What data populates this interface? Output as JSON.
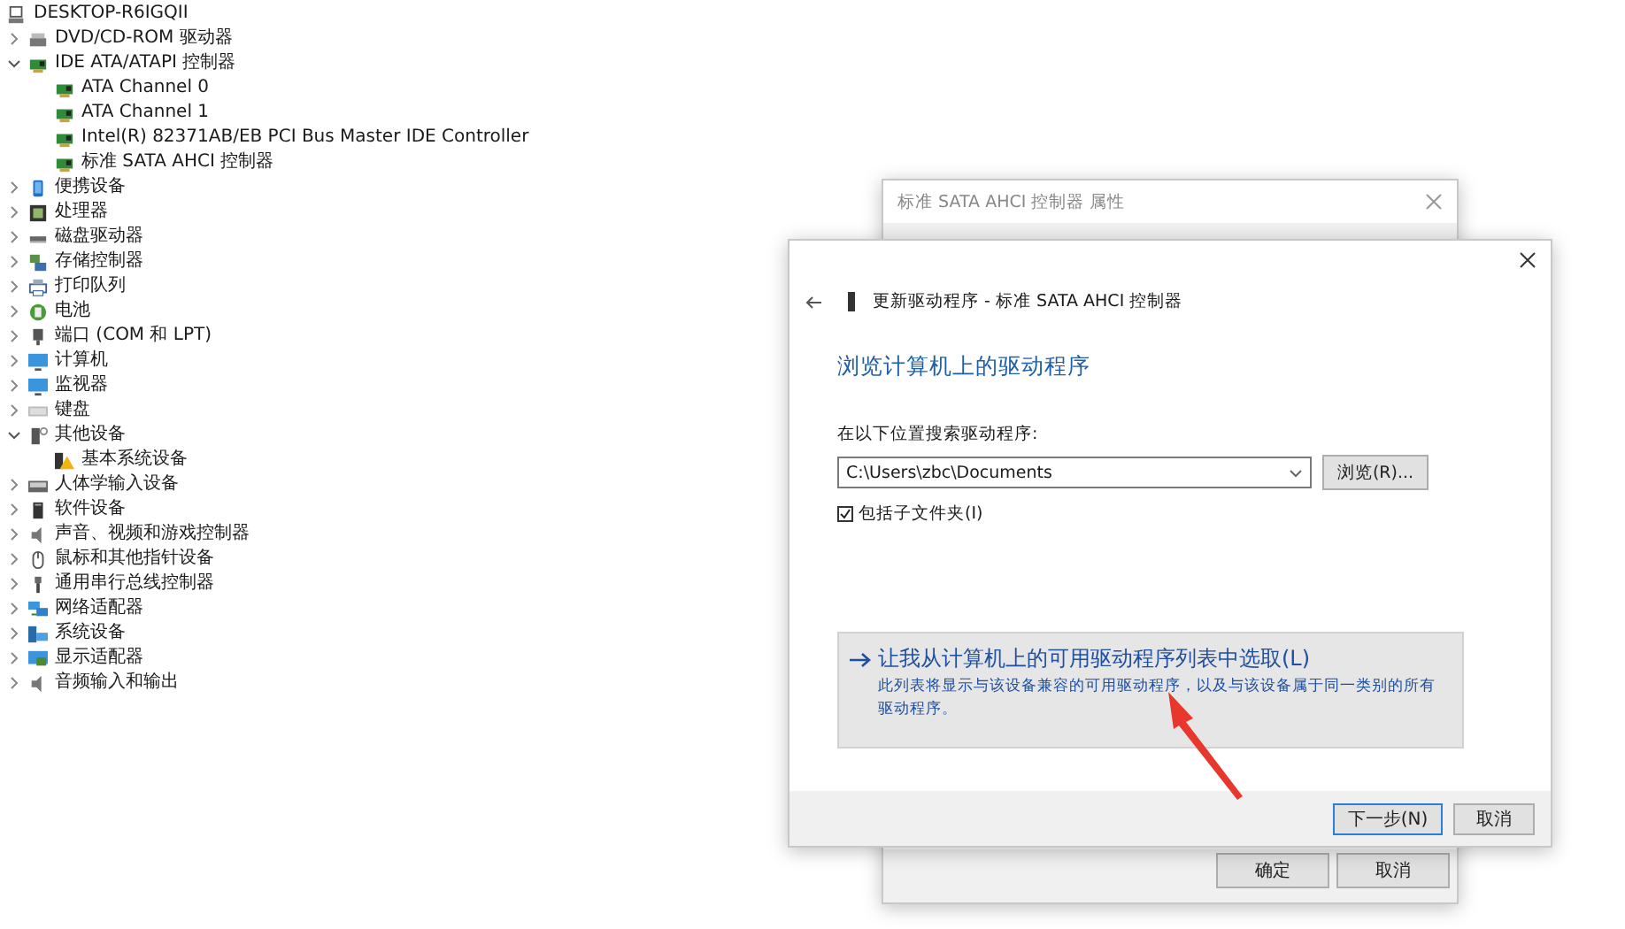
{
  "computer": {
    "label": "DESKTOP-R6IGQII"
  },
  "categories": [
    {
      "label": "DVD/CD-ROM 驱动器",
      "kind": "drive",
      "expanded": false
    },
    {
      "label": "IDE ATA/ATAPI 控制器",
      "kind": "controller",
      "expanded": true,
      "children": [
        {
          "label": "ATA Channel 0",
          "kind": "controller"
        },
        {
          "label": "ATA Channel 1",
          "kind": "controller"
        },
        {
          "label": "Intel(R) 82371AB/EB PCI Bus Master IDE Controller",
          "kind": "controller"
        },
        {
          "label": "标准 SATA AHCI 控制器",
          "kind": "controller"
        }
      ]
    },
    {
      "label": "便携设备",
      "kind": "portable",
      "expanded": false
    },
    {
      "label": "处理器",
      "kind": "chip",
      "expanded": false
    },
    {
      "label": "磁盘驱动器",
      "kind": "disk",
      "expanded": false
    },
    {
      "label": "存储控制器",
      "kind": "storage",
      "expanded": false
    },
    {
      "label": "打印队列",
      "kind": "printer",
      "expanded": false
    },
    {
      "label": "电池",
      "kind": "battery",
      "expanded": false
    },
    {
      "label": "端口 (COM 和 LPT)",
      "kind": "port",
      "expanded": false
    },
    {
      "label": "计算机",
      "kind": "monitor",
      "expanded": false
    },
    {
      "label": "监视器",
      "kind": "monitor",
      "expanded": false
    },
    {
      "label": "键盘",
      "kind": "keyboard",
      "expanded": false
    },
    {
      "label": "其他设备",
      "kind": "unknown",
      "expanded": true,
      "children": [
        {
          "label": "基本系统设备",
          "kind": "warning"
        }
      ]
    },
    {
      "label": "人体学输入设备",
      "kind": "hid",
      "expanded": false
    },
    {
      "label": "软件设备",
      "kind": "tower",
      "expanded": false
    },
    {
      "label": "声音、视频和游戏控制器",
      "kind": "speaker",
      "expanded": false
    },
    {
      "label": "鼠标和其他指针设备",
      "kind": "mouse",
      "expanded": false
    },
    {
      "label": "通用串行总线控制器",
      "kind": "usb",
      "expanded": false
    },
    {
      "label": "网络适配器",
      "kind": "network",
      "expanded": false
    },
    {
      "label": "系统设备",
      "kind": "system",
      "expanded": false
    },
    {
      "label": "显示适配器",
      "kind": "display",
      "expanded": false
    },
    {
      "label": "音频输入和输出",
      "kind": "speaker",
      "expanded": false
    }
  ],
  "properties_window": {
    "title": "标准 SATA AHCI 控制器 属性",
    "buttons": [
      "确定",
      "取消"
    ]
  },
  "wizard": {
    "title": "更新驱动程序 - 标准 SATA AHCI 控制器",
    "heading": "浏览计算机上的驱动程序",
    "location_label": "在以下位置搜索驱动程序:",
    "path": {
      "value": "C:\\Users\\zbc\\Documents"
    },
    "browse_button": "浏览(R)...",
    "include_subfolders": {
      "label": "包括子文件夹(I)",
      "checked": true
    },
    "option": {
      "title": "让我从计算机上的可用驱动程序列表中选取(L)",
      "description": "此列表将显示与该设备兼容的可用驱动程序，以及与该设备属于同一类别的所有驱动程序。"
    },
    "buttons": [
      {
        "label": "下一步(N)",
        "default": true
      },
      {
        "label": "取消",
        "default": false
      }
    ]
  }
}
